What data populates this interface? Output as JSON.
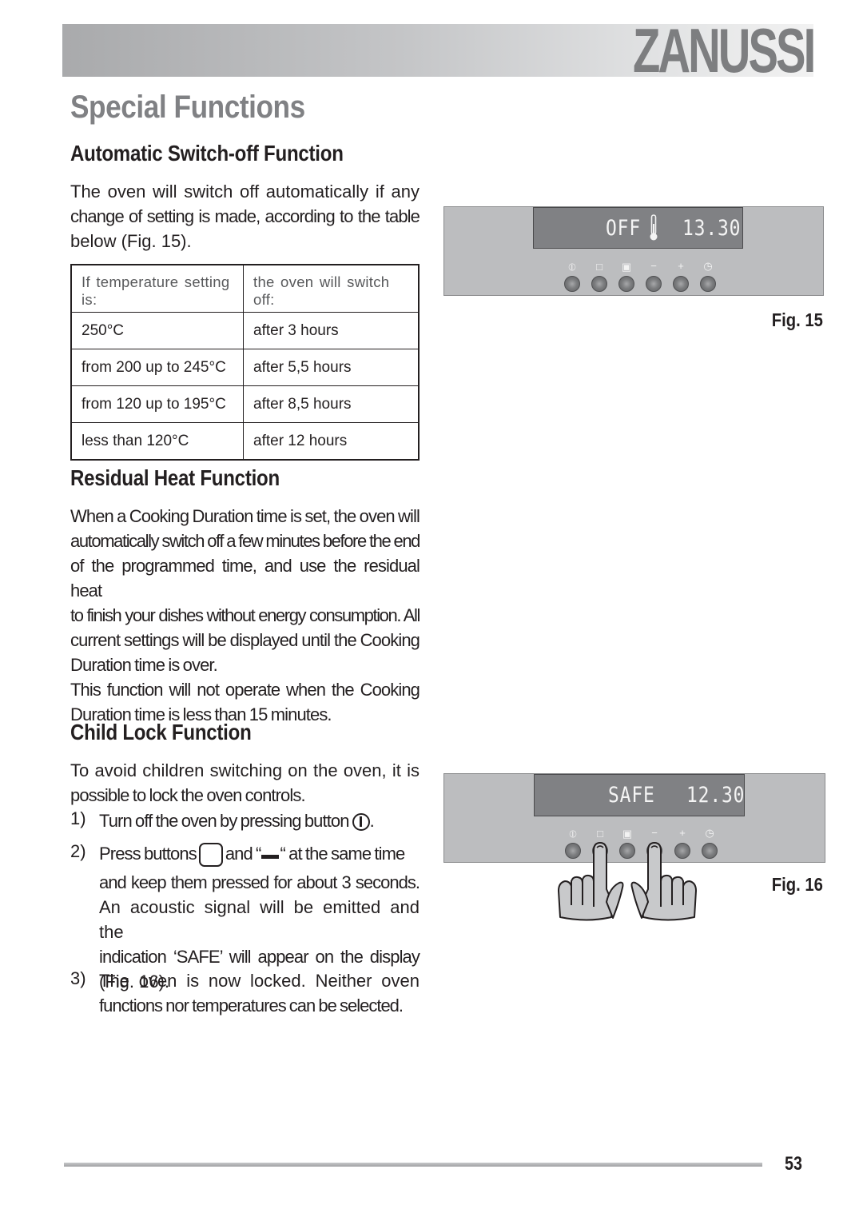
{
  "header": {
    "brand": "ZANUSSI"
  },
  "page_title": "Special Functions",
  "sections": {
    "auto_switch_off": {
      "heading": "Automatic Switch-off Function",
      "intro_lines": [
        "The oven will switch off automatically if any",
        "change of setting is made, according to the table",
        "below (Fig. 15)."
      ],
      "table": {
        "headers": [
          "If temperature setting is:",
          "the oven will switch off:"
        ],
        "rows": [
          [
            "250°C",
            "after 3 hours"
          ],
          [
            "from 200 up to 245°C",
            "after 5,5 hours"
          ],
          [
            "from 120 up to 195°C",
            "after 8,5 hours"
          ],
          [
            "less than 120°C",
            "after 12 hours"
          ]
        ]
      }
    },
    "residual_heat": {
      "heading": "Residual Heat Function",
      "lines": [
        "When a Cooking Duration time is set, the oven will",
        "automatically switch off a few minutes before the end",
        "of the programmed time, and use the residual heat",
        "to finish your dishes without energy consumption. All",
        "current settings will be displayed until the Cooking",
        "Duration time is over.",
        "This function will not operate when the Cooking",
        "Duration time is less than 15 minutes."
      ]
    },
    "child_lock": {
      "heading": "Child Lock Function",
      "intro_lines": [
        "To avoid children switching on the oven, it is",
        "possible to lock the oven controls."
      ],
      "steps": [
        {
          "num": "1)",
          "before": "Turn off the oven by pressing button",
          "after": "."
        },
        {
          "num": "2)",
          "before": "Press buttons",
          "middle": "and “",
          "after": "“ at the same time",
          "lines": [
            "and keep them pressed for about 3 seconds.",
            "An acoustic signal  will be emitted and the",
            "indication ‘SAFE’ will appear on the display",
            "(Fig. 16)."
          ]
        },
        {
          "num": "3)",
          "lines": [
            "The oven is now locked. Neither oven",
            "functions nor temperatures can be selected."
          ]
        }
      ]
    }
  },
  "figures": {
    "fig15": {
      "label": "Fig. 15",
      "display_text": "OFF",
      "display_time": "13.30",
      "button_symbols": [
        "power-icon",
        "square-icon",
        "square-dot-icon",
        "minus-icon",
        "plus-icon",
        "clock-icon"
      ]
    },
    "fig16": {
      "label": "Fig. 16",
      "display_text": "SAFE",
      "display_time": "12.30",
      "button_symbols": [
        "power-icon",
        "square-icon",
        "square-dot-icon",
        "minus-icon",
        "plus-icon",
        "clock-icon"
      ]
    }
  },
  "footer": {
    "page_number": "53"
  },
  "colors": {
    "title_gray": "#808184",
    "panel": "#bcbdbf",
    "display": "#808184",
    "text": "#231f20"
  }
}
